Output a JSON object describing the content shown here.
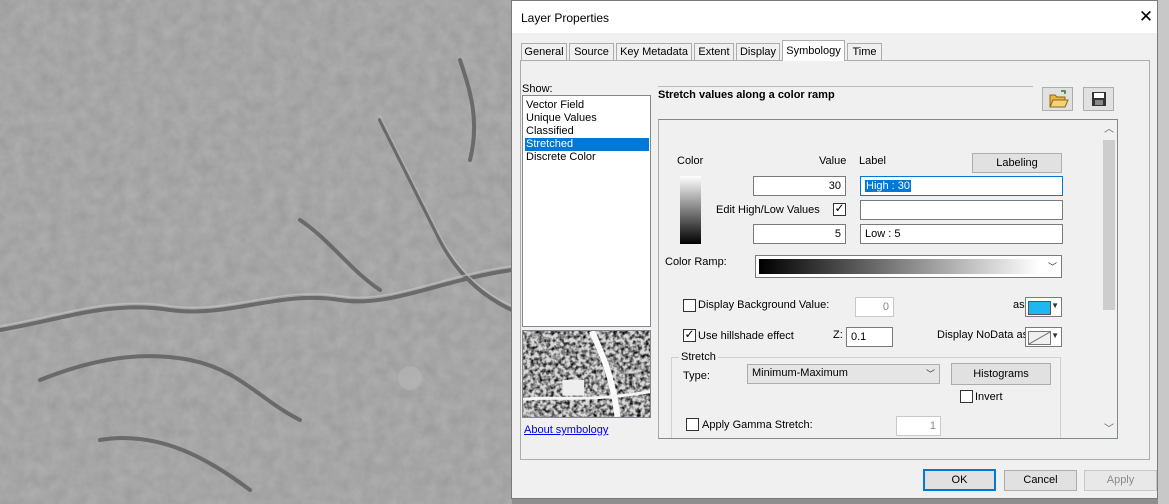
{
  "dialog": {
    "title": "Layer Properties",
    "tabs": [
      {
        "label": "General"
      },
      {
        "label": "Source"
      },
      {
        "label": "Key Metadata"
      },
      {
        "label": "Extent"
      },
      {
        "label": "Display"
      },
      {
        "label": "Symbology"
      },
      {
        "label": "Time"
      }
    ],
    "active_tab": "Symbology"
  },
  "show": {
    "label": "Show:",
    "items": [
      "Vector Field",
      "Unique Values",
      "Classified",
      "Stretched",
      "Discrete Color"
    ],
    "selected": "Stretched",
    "about_link": "About symbology"
  },
  "heading": "Stretch values along a color ramp",
  "toolbar_icons": [
    "open-folder-icon",
    "save-disk-icon"
  ],
  "ramp": {
    "color_header": "Color",
    "value_header": "Value",
    "label_header": "Label",
    "labeling_button": "Labeling",
    "high_value": "30",
    "high_label": "High : 30",
    "edit_high_low": "Edit High/Low Values",
    "edit_high_low_checked": true,
    "mid_label": "",
    "low_value": "5",
    "low_label": "Low : 5",
    "color_ramp_label": "Color Ramp:",
    "ramp_start_color": "#000000",
    "ramp_end_color": "#ffffff"
  },
  "background": {
    "label": "Display Background Value:",
    "checked": false,
    "value": "0",
    "as_label": "as",
    "color": "#1fb7f0"
  },
  "hillshade": {
    "label": "Use hillshade effect",
    "checked": true,
    "z_label": "Z:",
    "z_value": "0.1",
    "nodata_label": "Display NoData as"
  },
  "stretch": {
    "group_label": "Stretch",
    "type_label": "Type:",
    "type_value": "Minimum-Maximum",
    "histograms_button": "Histograms",
    "invert_label": "Invert",
    "invert_checked": false,
    "gamma_label": "Apply Gamma Stretch:",
    "gamma_checked": false,
    "gamma_value": "1"
  },
  "footer": {
    "ok": "OK",
    "cancel": "Cancel",
    "apply": "Apply"
  }
}
